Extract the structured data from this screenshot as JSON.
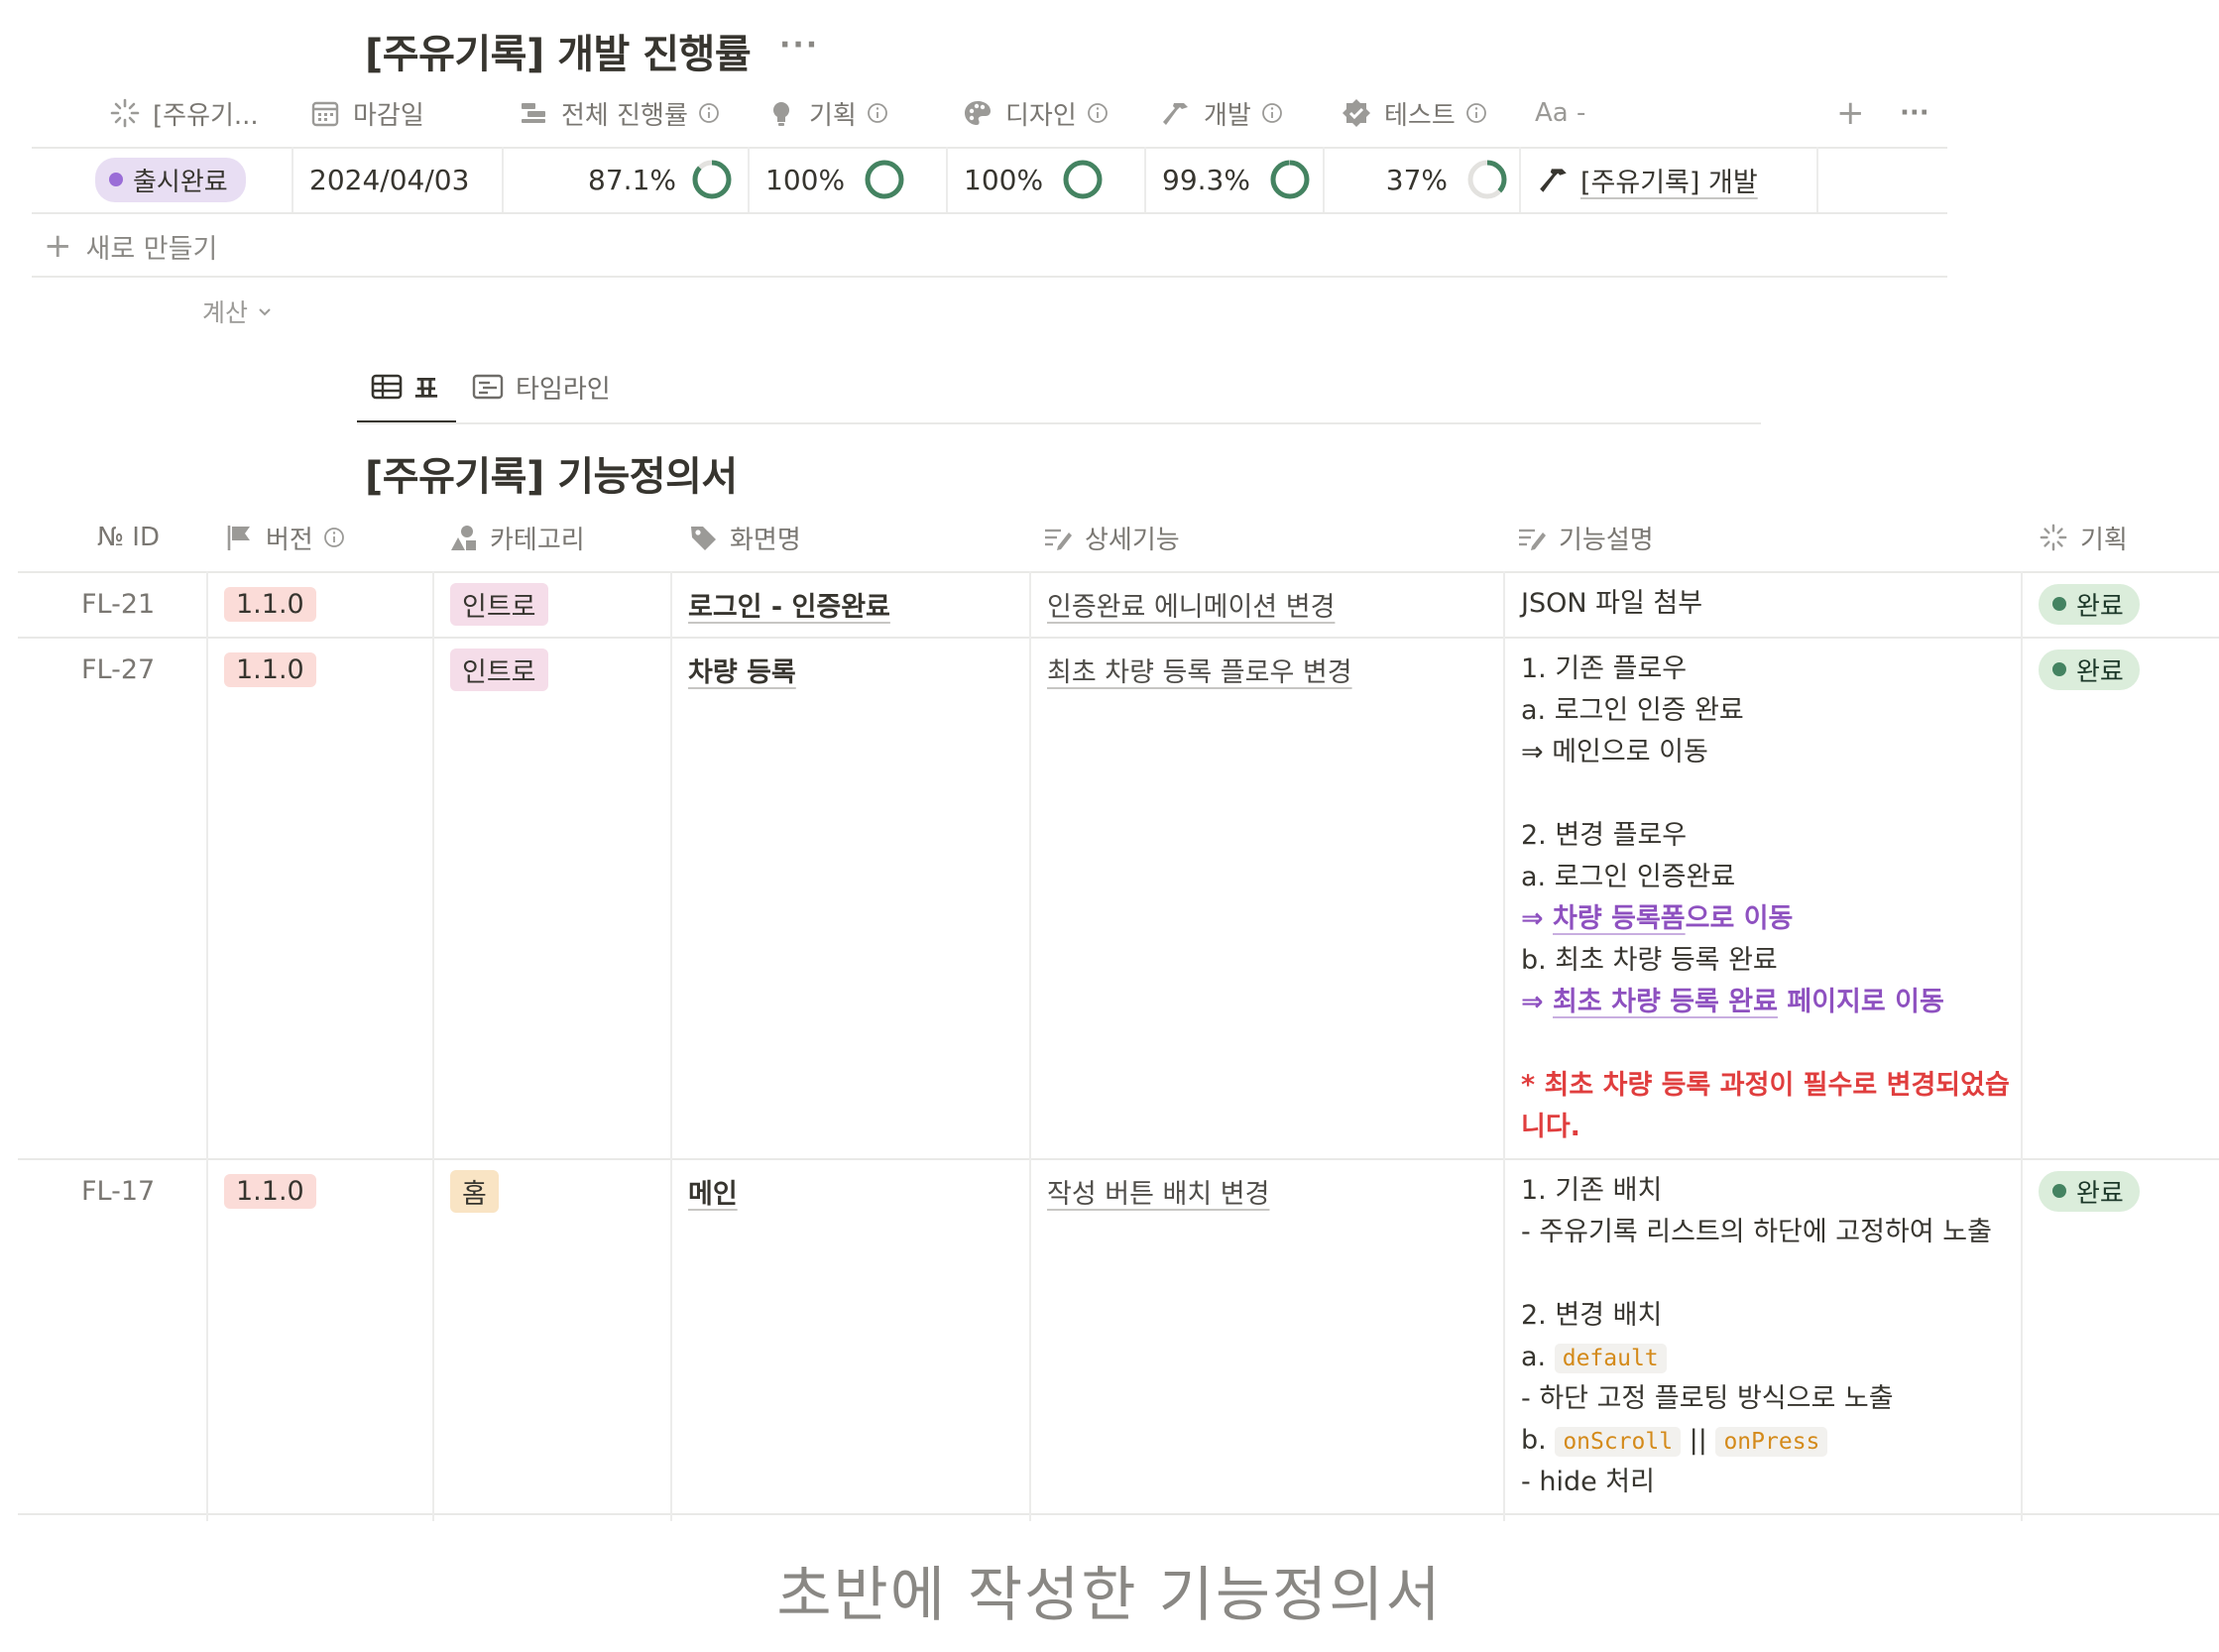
{
  "db_title": "[주유기록] 개발 진행률",
  "db_more": "···",
  "progress_headers": {
    "title": "[주유기...",
    "deadline": "마감일",
    "overall": "전체 진행률",
    "planning": "기획",
    "design": "디자인",
    "dev": "개발",
    "test": "테스트",
    "aa": "Aa -",
    "add": "+",
    "more": "···"
  },
  "progress_row": {
    "status": "출시완료",
    "date": "2024/04/03",
    "overall": "87.1%",
    "overall_value": 0.871,
    "planning": "100%",
    "planning_value": 1.0,
    "design": "100%",
    "design_value": 1.0,
    "dev": "99.3%",
    "dev_value": 0.993,
    "test": "37%",
    "test_value": 0.37,
    "relation": "[주유기록] 개발"
  },
  "add_new": "새로 만들기",
  "calc": "계산",
  "tabs": [
    {
      "label": "표"
    },
    {
      "label": "타임라인"
    }
  ],
  "spec_title": "[주유기록] 기능정의서",
  "table_headers": {
    "id": "№ ID",
    "version": "버전",
    "category": "카테고리",
    "screen": "화면명",
    "detail": "상세기능",
    "description": "기능설명",
    "planning": "기획"
  },
  "rows": [
    {
      "id": "FL-21",
      "version": "1.1.0",
      "category": "인트로",
      "screen": "로그인 - 인증완료",
      "detail": "인증완료 에니메이션 변경",
      "description": "JSON 파일 첨부",
      "planning": "완료"
    },
    {
      "id": "FL-27",
      "version": "1.1.0",
      "category": "인트로",
      "screen": "차량 등록",
      "detail": "최초 차량 등록 플로우 변경",
      "desc_lines": {
        "l1": "1. 기존 플로우",
        "l2": "a. 로그인 인증 완료",
        "l3": "⇒ 메인으로 이동",
        "l4": "2. 변경 플로우",
        "l5": "a. 로그인 인증완료",
        "l6_arrow": "⇒ ",
        "l6_link": "차량 등록폼",
        "l6_rest": "으로 이동",
        "l7": "b. 최초 차량 등록 완료",
        "l8_arrow": "⇒ ",
        "l8_link": "최초 차량 등록 완료",
        "l8_rest": " 페이지로 이동",
        "l9": "* 최초 차량 등록 과정이 필수로 변경되었습",
        "l10": "니다."
      },
      "planning": "완료"
    },
    {
      "id": "FL-17",
      "version": "1.1.0",
      "category": "홈",
      "screen": "메인",
      "detail": "작성 버튼 배치 변경",
      "desc_lines": {
        "l1": "1. 기존 배치",
        "l2": "- 주유기록 리스트의 하단에 고정하여 노출",
        "l3": "2. 변경 배치",
        "l4_prefix": "a. ",
        "l4_code": "default",
        "l5": "- 하단 고정 플로팅 방식으로 노출",
        "l6_prefix": "b. ",
        "l6_code1": "onScroll",
        "l6_mid": " || ",
        "l6_code2": "onPress",
        "l7": "- hide 처리"
      },
      "planning": "완료"
    }
  ],
  "caption": "초반에 작성한 기능정의서",
  "colors": {
    "ring": "#448361",
    "ring_track": "#e3e2df",
    "purple_dot": "#9a6dd7",
    "green_dot": "#448361"
  }
}
